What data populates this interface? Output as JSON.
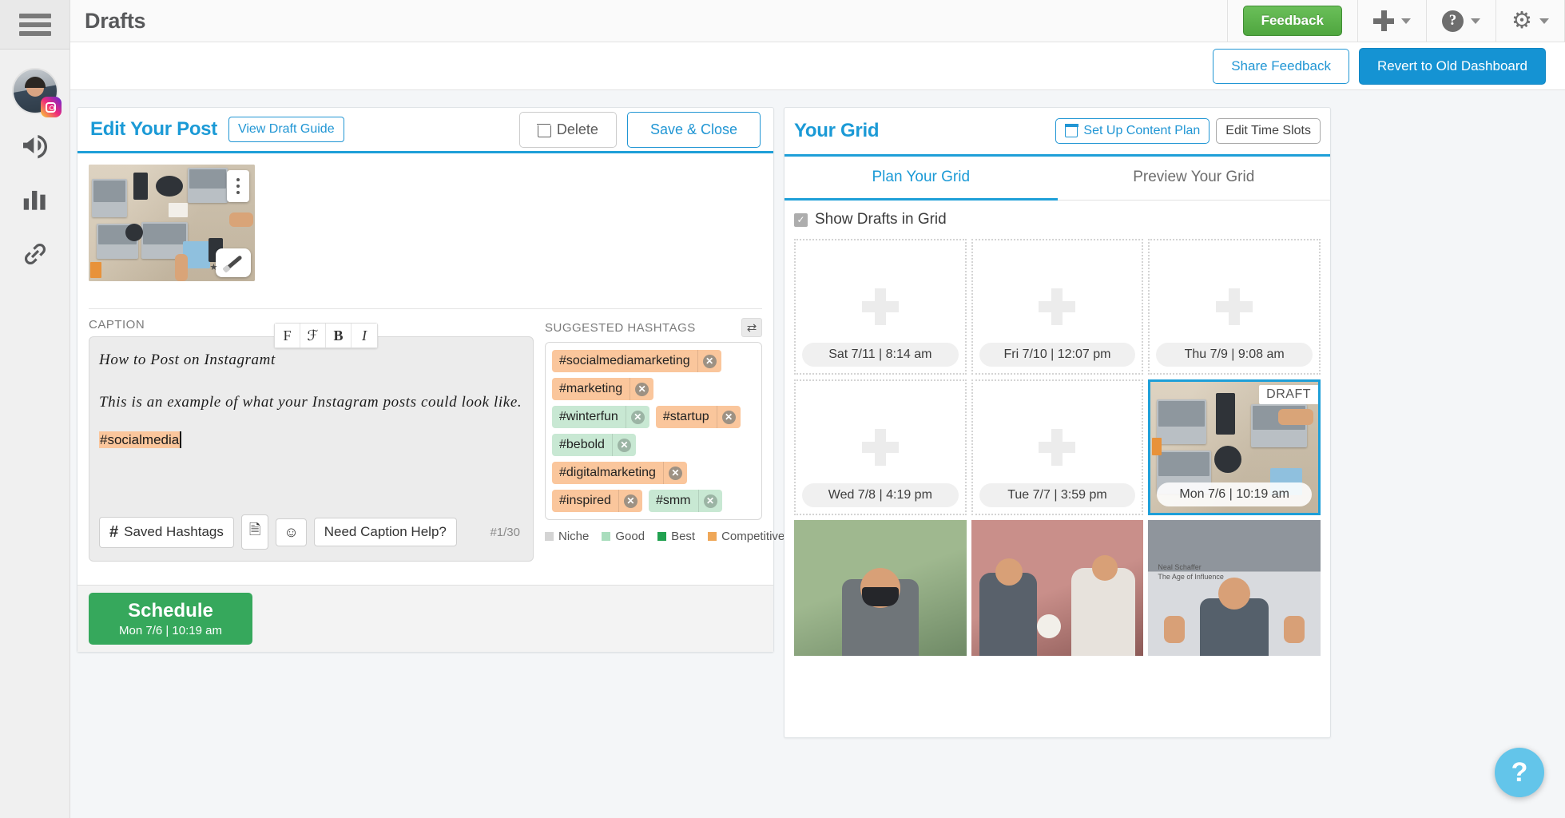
{
  "header": {
    "title": "Drafts",
    "feedback_label": "Feedback",
    "hamburger_icon": "hamburger-menu-icon",
    "plus_icon": "plus-icon",
    "help_icon": "question-mark-icon",
    "gear_icon": "gear-icon"
  },
  "subheader": {
    "share_feedback_label": "Share Feedback",
    "revert_label": "Revert to Old Dashboard"
  },
  "rail": {
    "avatar_name": "user-avatar",
    "items": [
      {
        "name": "megaphone-icon"
      },
      {
        "name": "analytics-bar-chart-icon"
      },
      {
        "name": "link-chain-icon"
      }
    ]
  },
  "editor": {
    "title": "Edit Your Post",
    "view_guide_label": "View Draft Guide",
    "delete_label": "Delete",
    "save_close_label": "Save & Close",
    "caption_label": "CAPTION",
    "format_buttons": [
      "F",
      "ℱ",
      "B",
      "I"
    ],
    "caption": {
      "line1": "How to Post on Instagramt",
      "line2": "This is an example of what your Instagram posts could look like.",
      "hashtag": "#socialmedia"
    },
    "toolbar": {
      "saved_hashtags_label": "Saved Hashtags",
      "hash_icon": "hash-icon",
      "duplicate_icon": "duplicate-icon",
      "emoji_icon": "smiley-face-icon",
      "caption_help_label": "Need Caption Help?",
      "char_count": "#1/30"
    },
    "schedule": {
      "main": "Schedule",
      "sub": "Mon 7/6 | 10:19 am"
    }
  },
  "hashtags": {
    "label": "SUGGESTED HASHTAGS",
    "shuffle_icon": "shuffle-icon",
    "tags": [
      {
        "label": "#socialmediamarketing",
        "quality": "competitive"
      },
      {
        "label": "#marketing",
        "quality": "competitive"
      },
      {
        "label": "#winterfun",
        "quality": "good"
      },
      {
        "label": "#startup",
        "quality": "competitive"
      },
      {
        "label": "#bebold",
        "quality": "good"
      },
      {
        "label": "#digitalmarketing",
        "quality": "competitive"
      },
      {
        "label": "#inspired",
        "quality": "competitive"
      },
      {
        "label": "#smm",
        "quality": "good"
      }
    ],
    "legend": [
      {
        "label": "Niche",
        "color": "#d4d4d4"
      },
      {
        "label": "Good",
        "color": "#a9ddbd"
      },
      {
        "label": "Best",
        "color": "#21a150"
      },
      {
        "label": "Competitive",
        "color": "#efa758"
      }
    ]
  },
  "grid": {
    "title": "Your Grid",
    "content_plan_label": "Set Up Content Plan",
    "calendar_icon": "calendar-icon",
    "edit_slots_label": "Edit Time Slots",
    "tabs": [
      {
        "label": "Plan Your Grid",
        "active": true
      },
      {
        "label": "Preview Your Grid",
        "active": false
      }
    ],
    "show_drafts_label": "Show Drafts in Grid",
    "show_drafts_checked": true,
    "cells": [
      {
        "time": "Sat 7/11 | 8:14 am",
        "type": "empty"
      },
      {
        "time": "Fri 7/10 | 12:07 pm",
        "type": "empty"
      },
      {
        "time": "Thu 7/9 | 9:08 am",
        "type": "empty"
      },
      {
        "time": "Wed 7/8 | 4:19 pm",
        "type": "empty"
      },
      {
        "time": "Tue 7/7 | 3:59 pm",
        "type": "empty"
      },
      {
        "time": "Mon 7/6 | 10:19 am",
        "type": "draft",
        "badge": "DRAFT"
      },
      {
        "time": "",
        "type": "photo1"
      },
      {
        "time": "",
        "type": "photo2"
      },
      {
        "time": "",
        "type": "photo3"
      }
    ]
  },
  "help_fab": {
    "label": "?"
  }
}
